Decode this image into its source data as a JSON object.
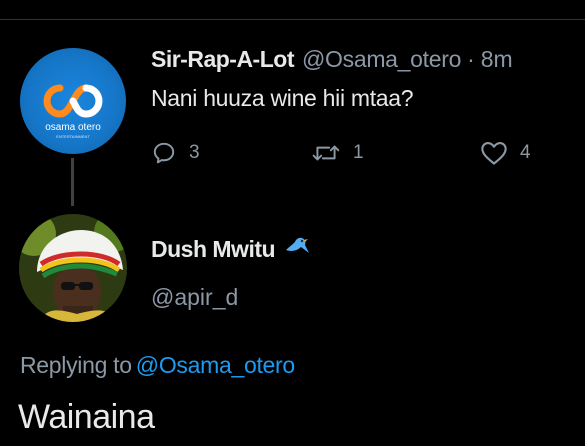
{
  "original_tweet": {
    "display_name": "Sir-Rap-A-Lot",
    "handle": "@Osama_otero",
    "separator": "·",
    "time": "8m",
    "text": "Nani huuza wine hii mtaa?",
    "avatar": {
      "logo_text": "osama otero",
      "logo_subtext": "ENTERTAINMENT",
      "logo_color": "#ff8a1e",
      "background": "#1677c9"
    },
    "actions": {
      "reply_count": "3",
      "retweet_count": "1",
      "like_count": "4",
      "reply_icon": "reply-icon",
      "retweet_icon": "retweet-icon",
      "like_icon": "heart-icon"
    }
  },
  "reply": {
    "display_name": "Dush Mwitu",
    "name_emoji": "bird-icon",
    "handle": "@apir_d",
    "replying_to_label": "Replying to",
    "replying_to_handle": "@Osama_otero",
    "text": "Wainaina"
  },
  "colors": {
    "background": "#000000",
    "primary_text": "#e7e9ea",
    "secondary_text": "#8b98a5",
    "accent": "#1d9bf0"
  }
}
